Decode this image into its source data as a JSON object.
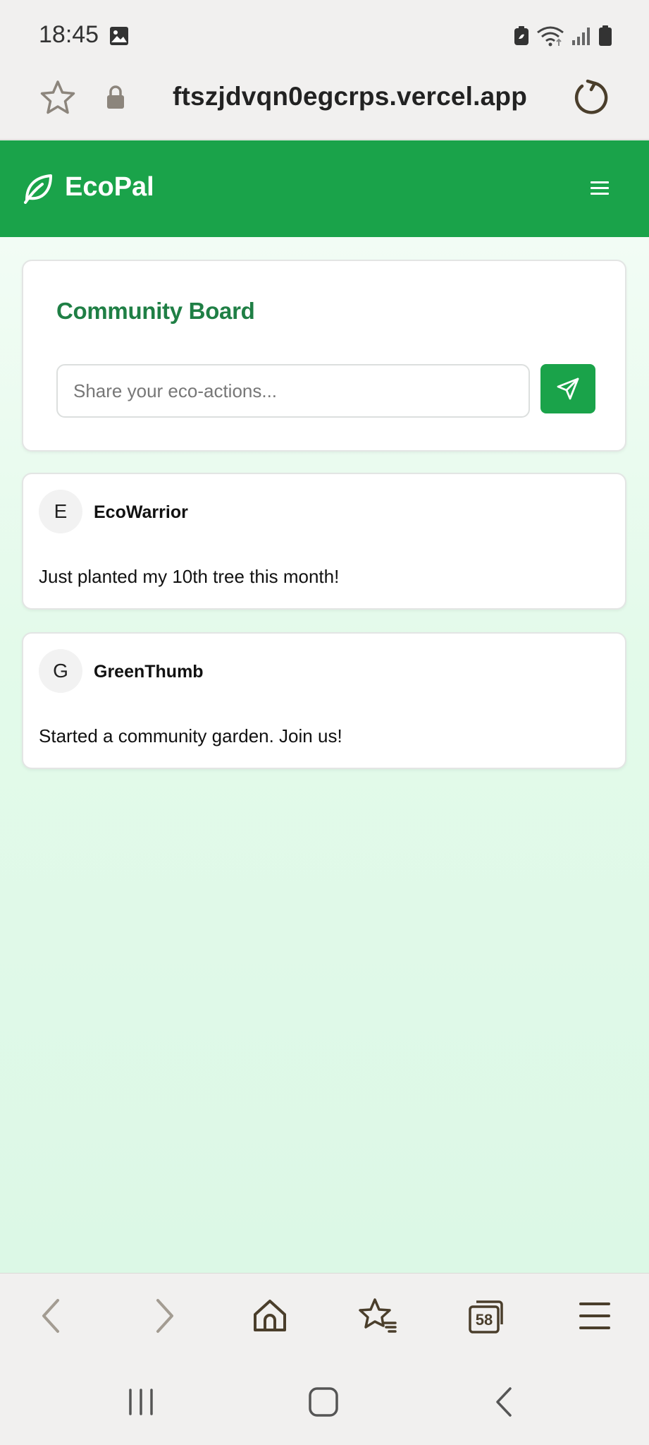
{
  "status_bar": {
    "time": "18:45"
  },
  "browser": {
    "url": "ftszjdvqn0egcrps.vercel.app",
    "tab_count": "58"
  },
  "app": {
    "brand": "EcoPal",
    "accent_color": "#1aa34a",
    "title_color": "#1f7f45"
  },
  "board": {
    "title": "Community Board",
    "input_value": "",
    "input_placeholder": "Share your eco-actions..."
  },
  "posts": [
    {
      "avatar": "E",
      "user": "EcoWarrior",
      "text": "Just planted my 10th tree this month!"
    },
    {
      "avatar": "G",
      "user": "GreenThumb",
      "text": "Started a community garden. Join us!"
    }
  ],
  "icons": {
    "status": [
      "image-icon",
      "battery-saver-icon",
      "wifi-icon",
      "signal-icon",
      "battery-icon"
    ],
    "url_bar": [
      "star-icon",
      "lock-icon",
      "reload-icon"
    ],
    "header": [
      "leaf-icon",
      "hamburger-menu-icon"
    ],
    "board": [
      "send-icon"
    ],
    "browser_bottom": [
      "back-arrow-icon",
      "forward-arrow-icon",
      "home-icon",
      "bookmarks-icon",
      "tabs-icon",
      "browser-menu-icon"
    ],
    "system_nav": [
      "recent-apps-icon",
      "home-square-icon",
      "nav-back-icon"
    ]
  }
}
